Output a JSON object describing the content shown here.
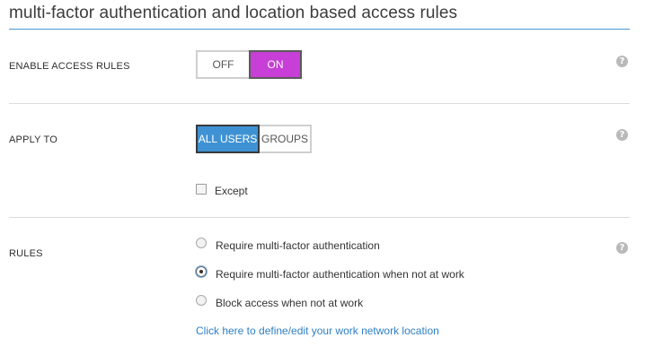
{
  "page": {
    "title": "multi-factor authentication and location based access rules"
  },
  "enable_access_rules": {
    "label": "ENABLE ACCESS RULES",
    "off_label": "OFF",
    "on_label": "ON",
    "selected": "ON",
    "on_color": "#c73fd6"
  },
  "apply_to": {
    "label": "APPLY TO",
    "all_users_label": "ALL USERS",
    "groups_label": "GROUPS",
    "selected": "ALL USERS",
    "selected_color": "#3e92d4",
    "except_label": "Except",
    "except_checked": false
  },
  "rules": {
    "label": "RULES",
    "options": [
      {
        "label": "Require multi-factor authentication",
        "selected": false
      },
      {
        "label": "Require multi-factor authentication when not at work",
        "selected": true
      },
      {
        "label": "Block access when not at work",
        "selected": false
      }
    ],
    "link_text": "Click here to define/edit your work network location"
  },
  "help": {
    "icon": "help-icon",
    "glyph": "?"
  }
}
